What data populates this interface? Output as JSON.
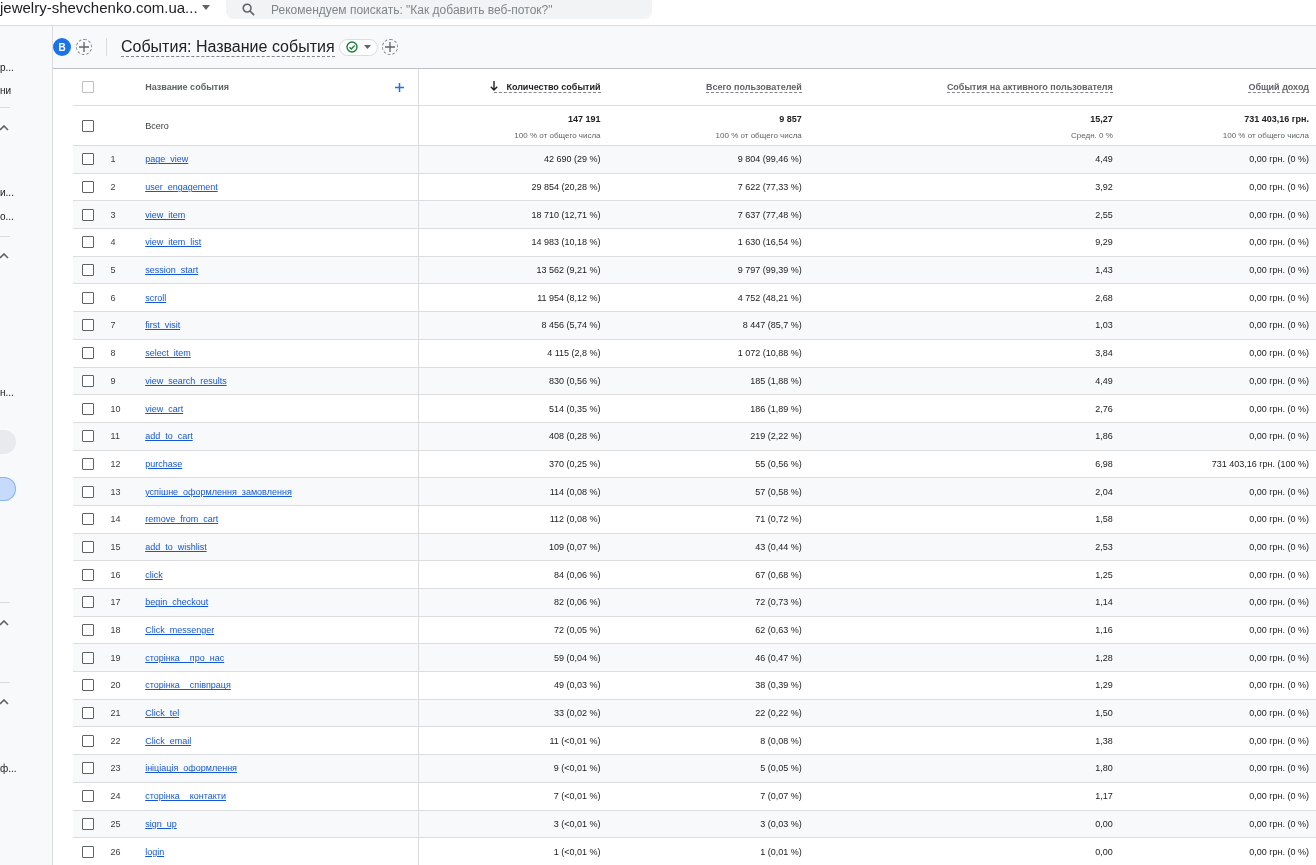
{
  "topbar": {
    "property": "jewelry-shevchenko.com.ua...",
    "search": {
      "placeholder": "Рекомендуем поискать: \"Как добавить веб-поток?\""
    }
  },
  "sidebar": {
    "items": [
      {
        "kind": "text",
        "label": "р...",
        "selected": false
      },
      {
        "kind": "text",
        "label": "ни",
        "selected": false
      },
      {
        "kind": "chevron",
        "selected": false
      },
      {
        "kind": "text",
        "label": "и...",
        "selected": false
      },
      {
        "kind": "text",
        "label": "о...",
        "selected": false
      },
      {
        "kind": "chevron",
        "selected": false
      },
      {
        "kind": "text",
        "label": "н...",
        "selected": false
      },
      {
        "kind": "pill",
        "selected": false
      },
      {
        "kind": "pill",
        "selected": true
      },
      {
        "kind": "chevron",
        "selected": false
      },
      {
        "kind": "chevron",
        "selected": false
      },
      {
        "kind": "text",
        "label": "ф...",
        "selected": false
      }
    ]
  },
  "report": {
    "segment_badge": "B",
    "title": "События: Название события"
  },
  "table": {
    "select_all_checked": false,
    "name_column": {
      "label": "Название события"
    },
    "columns": [
      {
        "label": "Количество событий",
        "sorted": true
      },
      {
        "label": "Всего пользователей",
        "sorted": false
      },
      {
        "label": "События на активного пользователя",
        "sorted": false
      },
      {
        "label": "Общий доход",
        "sorted": false
      }
    ],
    "totals": {
      "checked": false,
      "label": "Всего",
      "values": [
        {
          "value": "147 191",
          "note": "100 % от общего числа"
        },
        {
          "value": "9 857",
          "note": "100 % от общего числа"
        },
        {
          "value": "15,27",
          "note": "Средн. 0 %"
        },
        {
          "value": "731 403,16 грн.",
          "note": "100 % от общего числа"
        }
      ]
    },
    "rows": [
      {
        "checked": false,
        "number": "1",
        "name": "page_view",
        "cells": [
          "42 690 (29 %)",
          "9 804 (99,46 %)",
          "4,49",
          "0,00 грн. (0 %)"
        ]
      },
      {
        "checked": false,
        "number": "2",
        "name": "user_engagement",
        "cells": [
          "29 854 (20,28 %)",
          "7 622 (77,33 %)",
          "3,92",
          "0,00 грн. (0 %)"
        ]
      },
      {
        "checked": false,
        "number": "3",
        "name": "view_item",
        "cells": [
          "18 710 (12,71 %)",
          "7 637 (77,48 %)",
          "2,55",
          "0,00 грн. (0 %)"
        ]
      },
      {
        "checked": false,
        "number": "4",
        "name": "view_item_list",
        "cells": [
          "14 983 (10,18 %)",
          "1 630 (16,54 %)",
          "9,29",
          "0,00 грн. (0 %)"
        ]
      },
      {
        "checked": false,
        "number": "5",
        "name": "session_start",
        "cells": [
          "13 562 (9,21 %)",
          "9 797 (99,39 %)",
          "1,43",
          "0,00 грн. (0 %)"
        ]
      },
      {
        "checked": false,
        "number": "6",
        "name": "scroll",
        "cells": [
          "11 954 (8,12 %)",
          "4 752 (48,21 %)",
          "2,68",
          "0,00 грн. (0 %)"
        ]
      },
      {
        "checked": false,
        "number": "7",
        "name": "first_visit",
        "cells": [
          "8 456 (5,74 %)",
          "8 447 (85,7 %)",
          "1,03",
          "0,00 грн. (0 %)"
        ]
      },
      {
        "checked": false,
        "number": "8",
        "name": "select_item",
        "cells": [
          "4 115 (2,8 %)",
          "1 072 (10,88 %)",
          "3,84",
          "0,00 грн. (0 %)"
        ]
      },
      {
        "checked": false,
        "number": "9",
        "name": "view_search_results",
        "cells": [
          "830 (0,56 %)",
          "185 (1,88 %)",
          "4,49",
          "0,00 грн. (0 %)"
        ]
      },
      {
        "checked": false,
        "number": "10",
        "name": "view_cart",
        "cells": [
          "514 (0,35 %)",
          "186 (1,89 %)",
          "2,76",
          "0,00 грн. (0 %)"
        ]
      },
      {
        "checked": false,
        "number": "11",
        "name": "add_to_cart",
        "cells": [
          "408 (0,28 %)",
          "219 (2,22 %)",
          "1,86",
          "0,00 грн. (0 %)"
        ]
      },
      {
        "checked": false,
        "number": "12",
        "name": "purchase",
        "cells": [
          "370 (0,25 %)",
          "55 (0,56 %)",
          "6,98",
          "731 403,16 грн. (100 %)"
        ]
      },
      {
        "checked": false,
        "number": "13",
        "name": "успішне_оформлення_замовлення",
        "cells": [
          "114 (0,08 %)",
          "57 (0,58 %)",
          "2,04",
          "0,00 грн. (0 %)"
        ]
      },
      {
        "checked": false,
        "number": "14",
        "name": "remove_from_cart",
        "cells": [
          "112 (0,08 %)",
          "71 (0,72 %)",
          "1,58",
          "0,00 грн. (0 %)"
        ]
      },
      {
        "checked": false,
        "number": "15",
        "name": "add_to_wishlist",
        "cells": [
          "109 (0,07 %)",
          "43 (0,44 %)",
          "2,53",
          "0,00 грн. (0 %)"
        ]
      },
      {
        "checked": false,
        "number": "16",
        "name": "click",
        "cells": [
          "84 (0,06 %)",
          "67 (0,68 %)",
          "1,25",
          "0,00 грн. (0 %)"
        ]
      },
      {
        "checked": false,
        "number": "17",
        "name": "begin_checkout",
        "cells": [
          "82 (0,06 %)",
          "72 (0,73 %)",
          "1,14",
          "0,00 грн. (0 %)"
        ]
      },
      {
        "checked": false,
        "number": "18",
        "name": "Click_messenger",
        "cells": [
          "72 (0,05 %)",
          "62 (0,63 %)",
          "1,16",
          "0,00 грн. (0 %)"
        ]
      },
      {
        "checked": false,
        "number": "19",
        "name": "сторінка__про_нас",
        "cells": [
          "59 (0,04 %)",
          "46 (0,47 %)",
          "1,28",
          "0,00 грн. (0 %)"
        ]
      },
      {
        "checked": false,
        "number": "20",
        "name": "сторінка__співпраця",
        "cells": [
          "49 (0,03 %)",
          "38 (0,39 %)",
          "1,29",
          "0,00 грн. (0 %)"
        ]
      },
      {
        "checked": false,
        "number": "21",
        "name": "Click_tel",
        "cells": [
          "33 (0,02 %)",
          "22 (0,22 %)",
          "1,50",
          "0,00 грн. (0 %)"
        ]
      },
      {
        "checked": false,
        "number": "22",
        "name": "Click_email",
        "cells": [
          "11 (<0,01 %)",
          "8 (0,08 %)",
          "1,38",
          "0,00 грн. (0 %)"
        ]
      },
      {
        "checked": false,
        "number": "23",
        "name": "ініціація_оформлення",
        "cells": [
          "9 (<0,01 %)",
          "5 (0,05 %)",
          "1,80",
          "0,00 грн. (0 %)"
        ]
      },
      {
        "checked": false,
        "number": "24",
        "name": "сторінка__контакти",
        "cells": [
          "7 (<0,01 %)",
          "7 (0,07 %)",
          "1,17",
          "0,00 грн. (0 %)"
        ]
      },
      {
        "checked": false,
        "number": "25",
        "name": "sign_up",
        "cells": [
          "3 (<0,01 %)",
          "3 (0,03 %)",
          "0,00",
          "0,00 грн. (0 %)"
        ]
      },
      {
        "checked": false,
        "number": "26",
        "name": "login",
        "cells": [
          "1 (<0,01 %)",
          "1 (0,01 %)",
          "0,00",
          "0,00 грн. (0 %)"
        ]
      }
    ]
  }
}
